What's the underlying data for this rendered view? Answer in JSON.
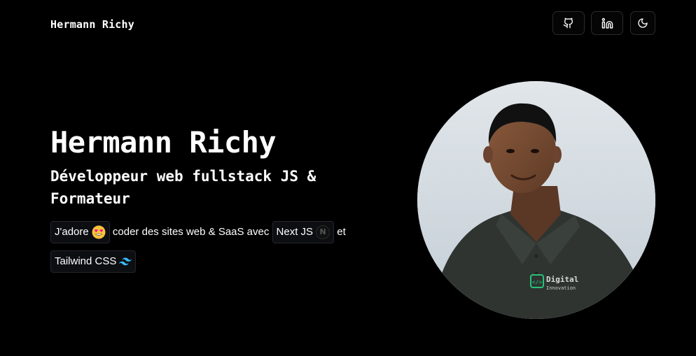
{
  "header": {
    "brand": "Hermann Richy",
    "buttons": [
      {
        "icon": "github-icon"
      },
      {
        "icon": "linkedin-icon"
      },
      {
        "icon": "moon-icon"
      }
    ]
  },
  "hero": {
    "name": "Hermann Richy",
    "role": "Développeur web fullstack JS & Formateur",
    "description": {
      "chip_love": "J'adore",
      "text_1": "coder des sites web & SaaS avec",
      "chip_next": "Next JS",
      "text_2": "et",
      "chip_tailwind": "Tailwind CSS"
    }
  },
  "profile_photo": {
    "shirt_logo_line1": "Digital",
    "shirt_logo_line2": "Innovation"
  },
  "colors": {
    "background": "#000000",
    "text": "#ffffff",
    "chip_border": "#26262b",
    "tailwind": "#38bdf8"
  }
}
